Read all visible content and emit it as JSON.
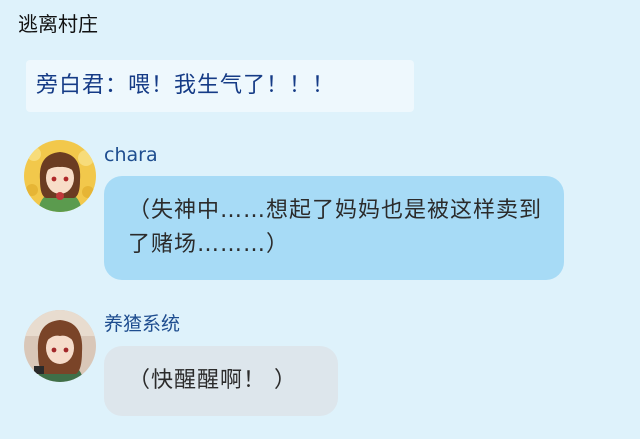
{
  "header": {
    "title": "逃离村庄"
  },
  "narration": {
    "text": "旁白君：喂！我生气了！！！"
  },
  "messages": [
    {
      "sender": "chara",
      "text": "（失神中……想起了妈妈也是被这样卖到了赌场………）"
    },
    {
      "sender": "养猹系统",
      "text": "（快醒醒啊！ ）"
    }
  ]
}
